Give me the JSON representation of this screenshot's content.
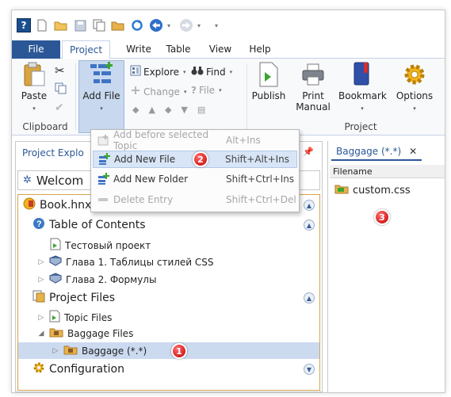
{
  "qat": {
    "icons": [
      "app-icon",
      "new-doc-icon",
      "open-folder-icon",
      "save-icon",
      "copy-icon",
      "folder-icon",
      "refresh-icon",
      "back-icon",
      "forward-icon",
      "customize-icon"
    ]
  },
  "tabs": [
    {
      "label": "File"
    },
    {
      "label": "Project"
    },
    {
      "label": "Write"
    },
    {
      "label": "Table"
    },
    {
      "label": "View"
    },
    {
      "label": "Help"
    }
  ],
  "ribbon": {
    "clipboard": {
      "paste": "Paste",
      "label": "Clipboard"
    },
    "add_file": "Add File",
    "explore": "Explore",
    "find": "Find",
    "change": "Change",
    "file": "File",
    "publish": "Publish",
    "print_manual_1": "Print",
    "print_manual_2": "Manual",
    "bookmark": "Bookmark",
    "options": "Options",
    "project_label": "Project"
  },
  "menu": {
    "items": [
      {
        "label": "Add before selected Topic",
        "shortcut": "Alt+Ins",
        "disabled": true
      },
      {
        "label": "Add New File",
        "shortcut": "Shift+Alt+Ins",
        "disabled": false
      },
      {
        "label": "Add New Folder",
        "shortcut": "Shift+Ctrl+Ins",
        "disabled": false
      },
      {
        "label": "Delete Entry",
        "shortcut": "Shift+Ctrl+Del",
        "disabled": true
      }
    ]
  },
  "left_panel": {
    "title": "Project Explo",
    "welcome": "Welcom",
    "book": "Book.hnxp",
    "toc": "Table of Contents",
    "topic1": "Тестовый проект",
    "topic2": "Глава 1. Таблицы стилей CSS",
    "topic3": "Глава 2. Формулы",
    "project_files": "Project Files",
    "topic_files": "Topic Files",
    "baggage_files": "Baggage Files",
    "baggage": "Baggage (*.*)",
    "configuration": "Configuration"
  },
  "right_panel": {
    "tab": "Baggage (*.*)",
    "close": "✕",
    "col_filename": "Filename",
    "file": "custom.css"
  },
  "callouts": {
    "one": "1",
    "two": "2",
    "three": "3"
  },
  "colors": {
    "accent": "#2b5797",
    "highlight": "#ccdaf0",
    "callout": "#d40000",
    "book_border": "#d5a54c"
  }
}
